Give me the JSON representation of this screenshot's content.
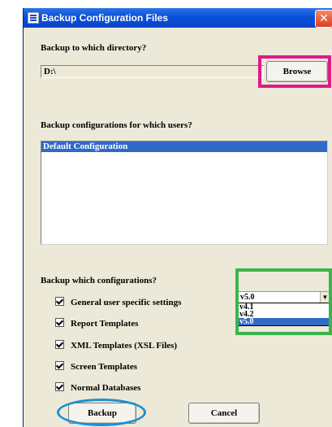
{
  "window": {
    "title": "Backup Configuration Files",
    "close_glyph": "✕"
  },
  "directory": {
    "label": "Backup to which directory?",
    "value": "D:\\",
    "browse_label": "Browse"
  },
  "users": {
    "label": "Backup configurations for which users?",
    "items": [
      "Default Configuration"
    ]
  },
  "configs": {
    "label": "Backup which configurations?",
    "checkboxes": [
      {
        "label": "General user specific settings",
        "checked": true
      },
      {
        "label": "Report Templates",
        "checked": true
      },
      {
        "label": "XML Templates (XSL Files)",
        "checked": true
      },
      {
        "label": "Screen Templates",
        "checked": true
      },
      {
        "label": "Normal Databases",
        "checked": true
      }
    ]
  },
  "version": {
    "selected": "v5.0",
    "options": [
      "v4.1",
      "v4.2",
      "v5.0"
    ]
  },
  "buttons": {
    "backup": "Backup",
    "cancel": "Cancel"
  },
  "colors": {
    "highlight_pink": "#e0198a",
    "highlight_green": "#3cb44b",
    "highlight_blue": "#1e90d0",
    "selection": "#316ac5"
  }
}
